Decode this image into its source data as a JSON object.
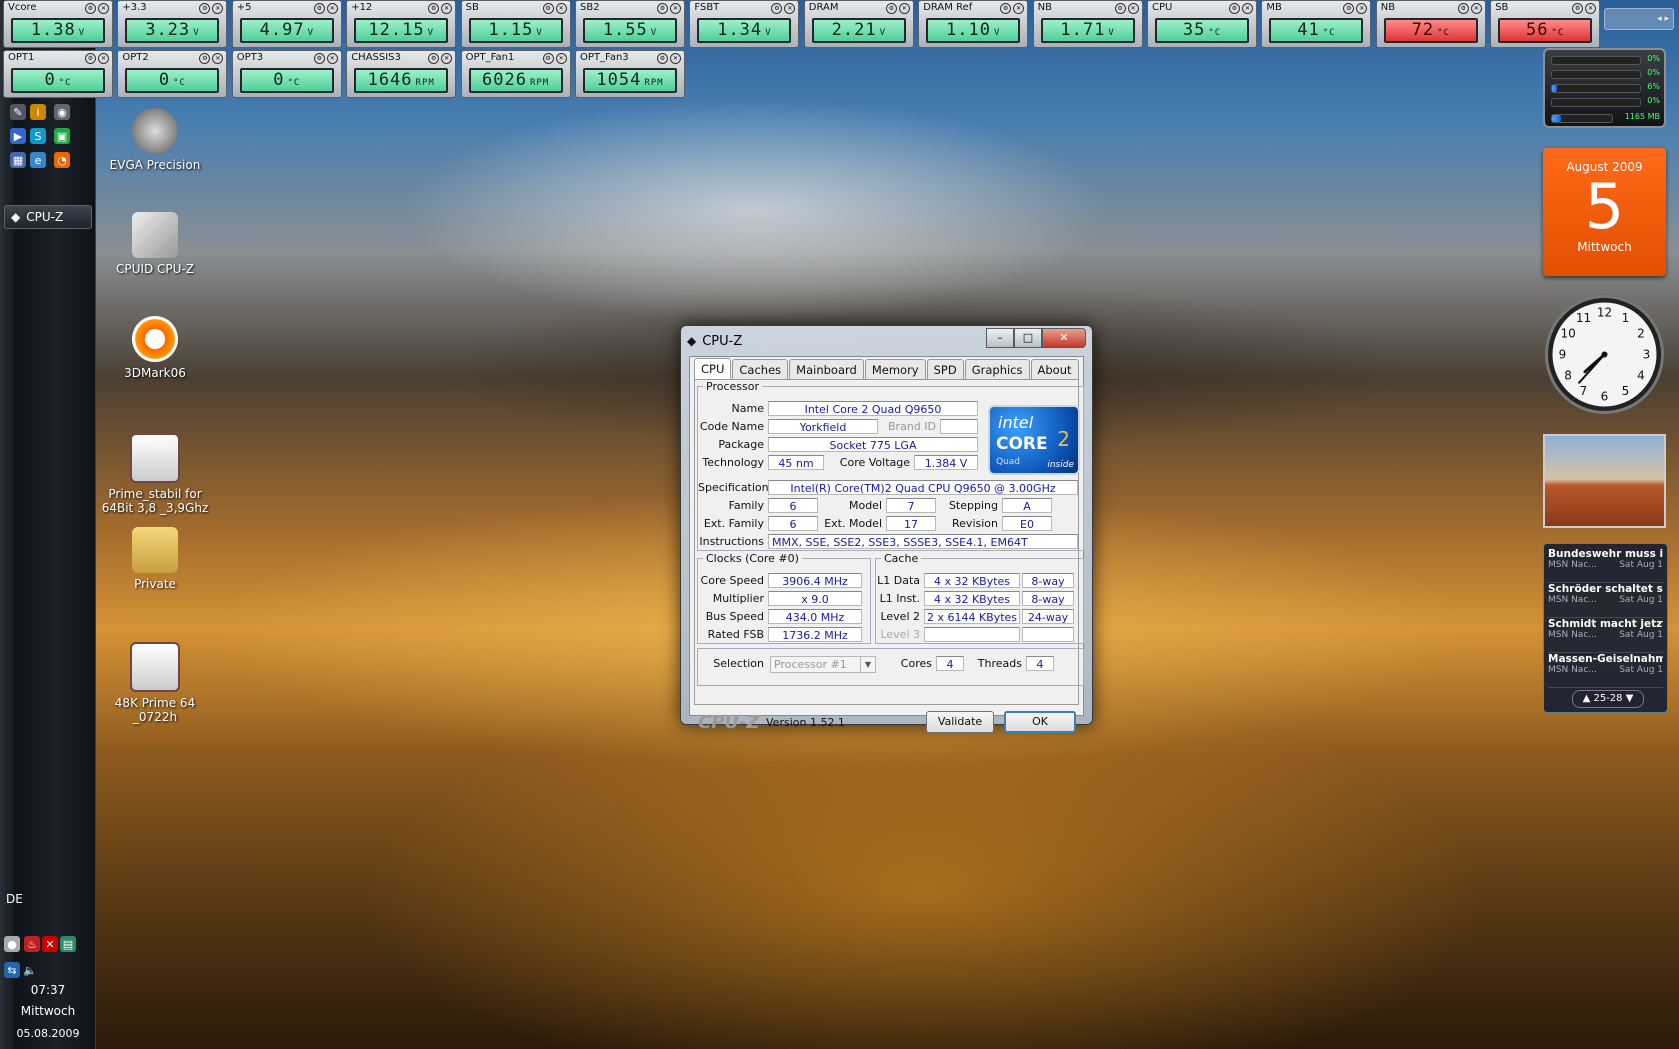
{
  "gauges_row1": [
    {
      "label": "Vcore",
      "value": "1.38",
      "unit": "V"
    },
    {
      "label": "+3.3",
      "value": "3.23",
      "unit": "V"
    },
    {
      "label": "+5",
      "value": "4.97",
      "unit": "V"
    },
    {
      "label": "+12",
      "value": "12.15",
      "unit": "V"
    },
    {
      "label": "SB",
      "value": "1.15",
      "unit": "V"
    },
    {
      "label": "SB2",
      "value": "1.55",
      "unit": "V"
    },
    {
      "label": "FSBT",
      "value": "1.34",
      "unit": "V"
    },
    {
      "label": "DRAM",
      "value": "2.21",
      "unit": "V"
    },
    {
      "label": "DRAM Ref",
      "value": "1.10",
      "unit": "V"
    },
    {
      "label": "NB",
      "value": "1.71",
      "unit": "V"
    },
    {
      "label": "CPU",
      "value": "35",
      "unit": "°C"
    },
    {
      "label": "MB",
      "value": "41",
      "unit": "°C"
    },
    {
      "label": "NB",
      "value": "72",
      "unit": "°C"
    },
    {
      "label": "SB",
      "value": "56",
      "unit": "°C"
    }
  ],
  "gauges_row2": [
    {
      "label": "OPT1",
      "value": "0",
      "unit": "°C"
    },
    {
      "label": "OPT2",
      "value": "0",
      "unit": "°C"
    },
    {
      "label": "OPT3",
      "value": "0",
      "unit": "°C"
    },
    {
      "label": "CHASSIS3",
      "value": "1646",
      "unit": "RPM"
    },
    {
      "label": "OPT_Fan1",
      "value": "6026",
      "unit": "RPM"
    },
    {
      "label": "OPT_Fan3",
      "value": "1054",
      "unit": "RPM"
    }
  ],
  "taskbar": {
    "task_button": "CPU-Z",
    "language": "DE",
    "time": "07:37",
    "weekday": "Mittwoch",
    "date": "05.08.2009"
  },
  "desktop_icons": [
    {
      "label": "EVGA Precision"
    },
    {
      "label": "CPUID CPU-Z"
    },
    {
      "label": "3DMark06"
    },
    {
      "label": "Prime_stabil for 64Bit 3,8 _3,9Ghz"
    },
    {
      "label": "Private"
    },
    {
      "label": "48K Prime 64 _0722h"
    }
  ],
  "cpuz": {
    "title": "CPU-Z",
    "tabs": [
      "CPU",
      "Caches",
      "Mainboard",
      "Memory",
      "SPD",
      "Graphics",
      "About"
    ],
    "processor": {
      "legend": "Processor",
      "name_label": "Name",
      "name": "Intel Core 2 Quad Q9650",
      "codename_label": "Code Name",
      "codename": "Yorkfield",
      "brandid_label": "Brand ID",
      "brandid": "",
      "package_label": "Package",
      "package": "Socket 775 LGA",
      "technology_label": "Technology",
      "technology": "45 nm",
      "corevoltage_label": "Core Voltage",
      "corevoltage": "1.384 V",
      "spec_label": "Specification",
      "spec": "Intel(R) Core(TM)2 Quad CPU    Q9650  @ 3.00GHz",
      "family_label": "Family",
      "family": "6",
      "model_label": "Model",
      "model": "7",
      "stepping_label": "Stepping",
      "stepping": "A",
      "extfamily_label": "Ext. Family",
      "extfamily": "6",
      "extmodel_label": "Ext. Model",
      "extmodel": "17",
      "revision_label": "Revision",
      "revision": "E0",
      "instructions_label": "Instructions",
      "instructions": "MMX, SSE, SSE2, SSE3, SSSE3, SSE4.1, EM64T"
    },
    "logo": {
      "brand": "intel",
      "line": "CORE",
      "sub": "Quad",
      "inside": "inside",
      "gen": "2"
    },
    "clocks": {
      "legend": "Clocks (Core #0)",
      "corespeed_label": "Core Speed",
      "corespeed": "3906.4 MHz",
      "multiplier_label": "Multiplier",
      "multiplier": "x 9.0",
      "busspeed_label": "Bus Speed",
      "busspeed": "434.0 MHz",
      "ratedfsb_label": "Rated FSB",
      "ratedfsb": "1736.2 MHz"
    },
    "cache": {
      "legend": "Cache",
      "l1data_label": "L1 Data",
      "l1data": "4 x 32 KBytes",
      "l1data_way": "8-way",
      "l1inst_label": "L1 Inst.",
      "l1inst": "4 x 32 KBytes",
      "l1inst_way": "8-way",
      "level2_label": "Level 2",
      "level2": "2 x 6144 KBytes",
      "level2_way": "24-way",
      "level3_label": "Level 3",
      "level3": "",
      "level3_way": ""
    },
    "selection_label": "Selection",
    "selection": "Processor #1",
    "cores_label": "Cores",
    "cores": "4",
    "threads_label": "Threads",
    "threads": "4",
    "brand": "CPU-Z",
    "version": "Version 1.52.1",
    "validate": "Validate",
    "ok": "OK"
  },
  "sidebar": {
    "meter_pcts": [
      "0%",
      "0%",
      "6%",
      "0%"
    ],
    "meter_fills": [
      0,
      0,
      0.06,
      0
    ],
    "memory_fill": 0.15,
    "memory": "1165 MB",
    "calendar": {
      "month": "August 2009",
      "day": "5",
      "weekday": "Mittwoch"
    },
    "clock": {
      "time": "07:37"
    },
    "news": [
      {
        "headline": "Bundeswehr muss i...",
        "source": "MSN Nac...",
        "date": "Sat Aug 1"
      },
      {
        "headline": "Schröder schaltet sic...",
        "source": "MSN Nac...",
        "date": "Sat Aug 1"
      },
      {
        "headline": "Schmidt macht jetzt ...",
        "source": "MSN Nac...",
        "date": "Sat Aug 1"
      },
      {
        "headline": "Massen-Geiselnahm...",
        "source": "MSN Nac...",
        "date": "Sat Aug 1"
      }
    ],
    "news_range": "25-28"
  }
}
